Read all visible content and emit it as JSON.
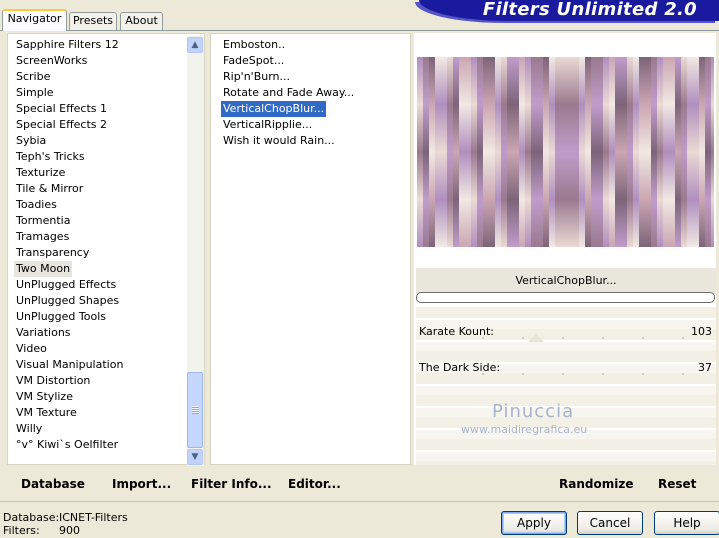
{
  "tabs": [
    {
      "label": "Navigator",
      "active": true
    },
    {
      "label": "Presets",
      "active": false
    },
    {
      "label": "About",
      "active": false
    }
  ],
  "banner": {
    "title": "Filters Unlimited 2.0",
    "color": "#1a1a9e"
  },
  "categories": {
    "items": [
      "Sapphire Filters 12",
      "ScreenWorks",
      "Scribe",
      "Simple",
      "Special Effects 1",
      "Special Effects 2",
      "Sybia",
      "Teph's Tricks",
      "Texturize",
      "Tile & Mirror",
      "Toadies",
      "Tormentia",
      "Tramages",
      "Transparency",
      "Two Moon",
      "UnPlugged Effects",
      "UnPlugged Shapes",
      "UnPlugged Tools",
      "Variations",
      "Video",
      "Visual Manipulation",
      "VM Distortion",
      "VM Stylize",
      "VM Texture",
      "Willy",
      "°v° Kiwi`s Oelfilter"
    ],
    "selected": "Two Moon",
    "scroll_position": 0.9
  },
  "filters": {
    "items": [
      "Emboston..",
      "FadeSpot...",
      "Rip'n'Burn...",
      "Rotate and Fade Away...",
      "VerticalChopBlur...",
      "VerticalRipplie...",
      "Wish it would Rain..."
    ],
    "selected": "VerticalChopBlur...",
    "selected_color": "#316ac5"
  },
  "preview": {
    "filter_name": "VerticalChopBlur...",
    "palette": [
      "#a67fb6",
      "#6b4f66",
      "#e8d5cf",
      "#c49aa8",
      "#8d6780",
      "#f0e6e0",
      "#b88fc4"
    ]
  },
  "controls": [
    {
      "label": "Karate Kount:",
      "value": "103"
    },
    {
      "label": "The Dark Side:",
      "value": "37"
    }
  ],
  "watermark": {
    "name": "Pinuccia",
    "url": "www.maidiregrafica.eu"
  },
  "toolbar": {
    "database": "Database",
    "import": "Import...",
    "filter_info": "Filter Info...",
    "editor": "Editor...",
    "randomize": "Randomize",
    "reset": "Reset"
  },
  "status": {
    "database_label": "Database:",
    "database_value": "ICNET-Filters",
    "filters_label": "Filters:",
    "filters_value": "900"
  },
  "buttons": {
    "apply": "Apply",
    "cancel": "Cancel",
    "help": "Help"
  }
}
